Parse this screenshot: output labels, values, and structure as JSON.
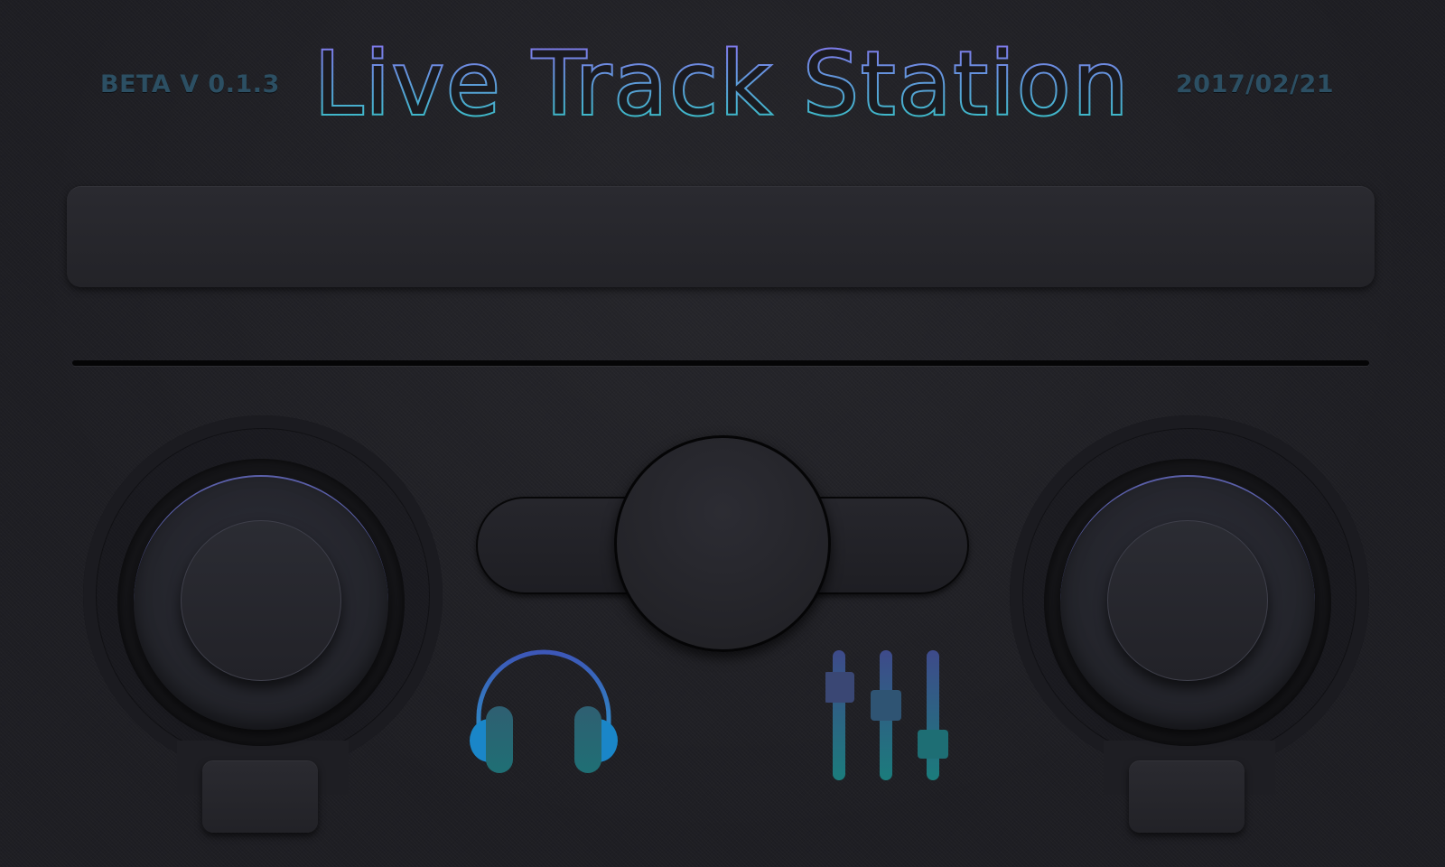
{
  "header": {
    "version": "BETA V 0.1.3",
    "title": "Live Track Station",
    "date": "2017/02/21"
  },
  "colors": {
    "background": "#1e1e23",
    "title_gradient_start": "#8a6ff0",
    "title_gradient_end": "#2ec8c0",
    "accent_blue": "#1e7bc0",
    "accent_teal": "#1d8a86",
    "wheel_rim": "#5a5fa8"
  },
  "icons": {
    "headphones": "headphones-icon",
    "mixer": "sliders-icon"
  }
}
